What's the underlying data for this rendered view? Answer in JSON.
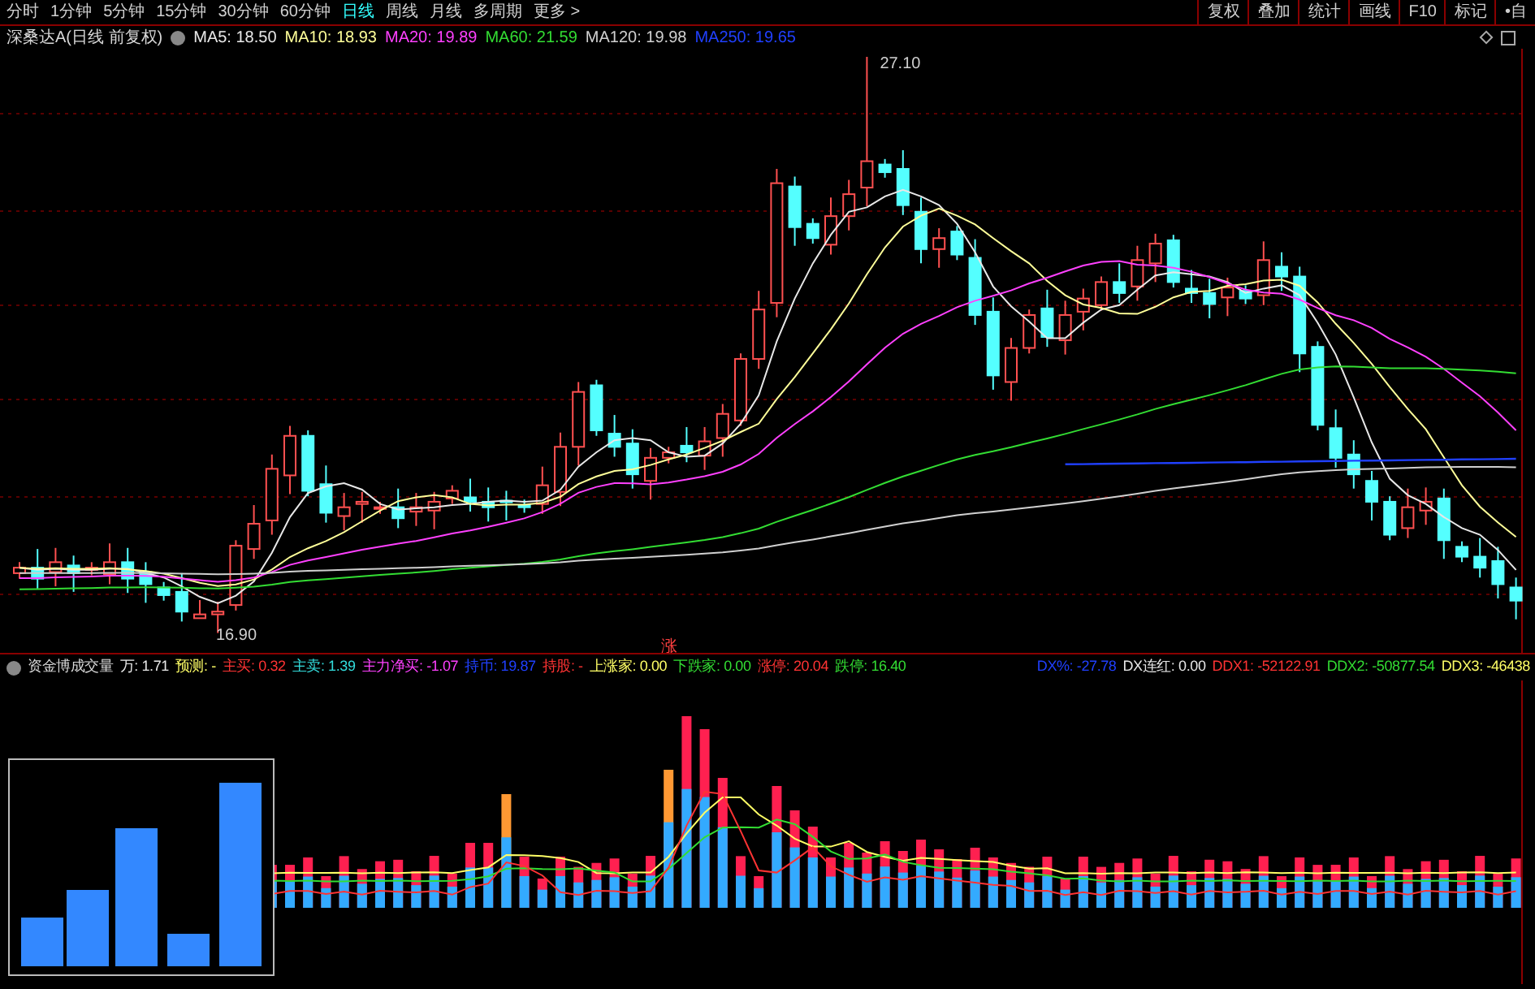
{
  "period_tabs": [
    {
      "label": "分时",
      "selected": false
    },
    {
      "label": "1分钟",
      "selected": false
    },
    {
      "label": "5分钟",
      "selected": false
    },
    {
      "label": "15分钟",
      "selected": false
    },
    {
      "label": "30分钟",
      "selected": false
    },
    {
      "label": "60分钟",
      "selected": false
    },
    {
      "label": "日线",
      "selected": true
    },
    {
      "label": "周线",
      "selected": false
    },
    {
      "label": "月线",
      "selected": false
    },
    {
      "label": "多周期",
      "selected": false
    }
  ],
  "more_link": "更多 >",
  "toolbar_buttons": [
    "复权",
    "叠加",
    "统计",
    "画线",
    "F10",
    "标记",
    "•自"
  ],
  "main_chart": {
    "title": "深桑达A(日线 前复权)",
    "ma_legend": [
      {
        "label": "MA5: 18.50",
        "color": "#e8e8e8"
      },
      {
        "label": "MA10: 18.93",
        "color": "#ffff99"
      },
      {
        "label": "MA20: 19.89",
        "color": "#ff40ff"
      },
      {
        "label": "MA60: 21.59",
        "color": "#33dd33"
      },
      {
        "label": "MA120: 19.98",
        "color": "#d0d0d0"
      },
      {
        "label": "MA250: 19.65",
        "color": "#2040ff"
      }
    ],
    "high_label": "27.10",
    "low_label": "16.90",
    "marker": "涨"
  },
  "indicator": {
    "title": "资金博成交量",
    "items": [
      {
        "label": "万: 1.71",
        "color": "#e8e8e8"
      },
      {
        "label": "预测: -",
        "color": "#ffff66"
      },
      {
        "label": "主买: 0.32",
        "color": "#ff3333"
      },
      {
        "label": "主卖: 1.39",
        "color": "#33dddd"
      },
      {
        "label": "主力净买: -1.07",
        "color": "#ff40ff"
      },
      {
        "label": "持币: 19.87",
        "color": "#2040ff"
      },
      {
        "label": "持股: -",
        "color": "#ff3333"
      },
      {
        "label": "上涨家: 0.00",
        "color": "#ffff66"
      },
      {
        "label": "下跌家: 0.00",
        "color": "#33dd33"
      },
      {
        "label": "涨停: 20.04",
        "color": "#ff3333"
      },
      {
        "label": "跌停: 16.40",
        "color": "#33dd33"
      }
    ],
    "right_items": [
      {
        "label": "DX%: -27.78",
        "color": "#2040ff"
      },
      {
        "label": "DX连红: 0.00",
        "color": "#e8e8e8"
      },
      {
        "label": "DDX1: -52122.91",
        "color": "#ff3333"
      },
      {
        "label": "DDX2: -50877.54",
        "color": "#33dd33"
      },
      {
        "label": "DDX3: -46438",
        "color": "#ffff66"
      }
    ]
  }
}
